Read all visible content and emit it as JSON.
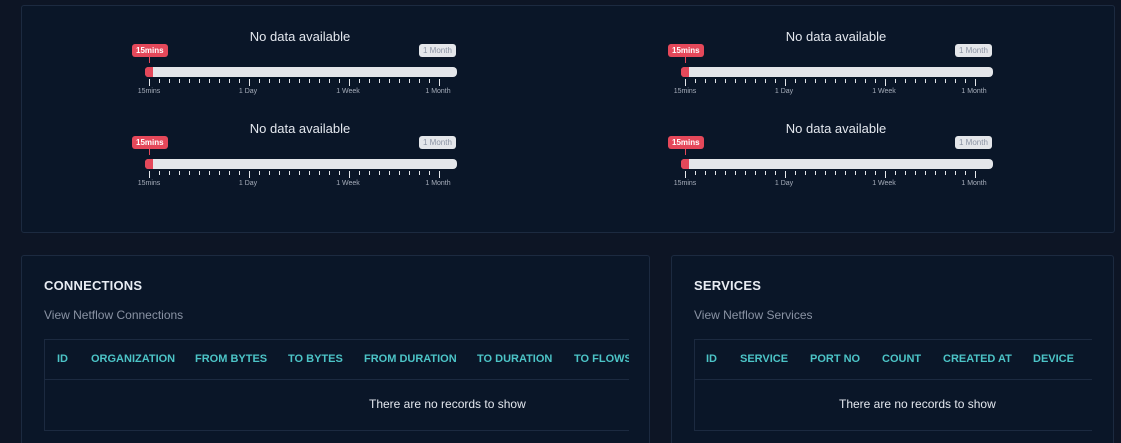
{
  "range_widgets": [
    {
      "nodata": "No data available",
      "min_label": "15mins",
      "max_label": "1 Month",
      "ticks": [
        "15mins",
        "1 Day",
        "1 Week",
        "1 Month"
      ]
    },
    {
      "nodata": "No data available",
      "min_label": "15mins",
      "max_label": "1 Month",
      "ticks": [
        "15mins",
        "1 Day",
        "1 Week",
        "1 Month"
      ]
    },
    {
      "nodata": "No data available",
      "min_label": "15mins",
      "max_label": "1 Month",
      "ticks": [
        "15mins",
        "1 Day",
        "1 Week",
        "1 Month"
      ]
    },
    {
      "nodata": "No data available",
      "min_label": "15mins",
      "max_label": "1 Month",
      "ticks": [
        "15mins",
        "1 Day",
        "1 Week",
        "1 Month"
      ]
    }
  ],
  "connections": {
    "title": "CONNECTIONS",
    "subtitle": "View Netflow Connections",
    "columns": [
      "ID",
      "ORGANIZATION",
      "FROM BYTES",
      "TO BYTES",
      "FROM DURATION",
      "TO DURATION",
      "TO FLOWS"
    ],
    "empty_text": "There are no records to show"
  },
  "services": {
    "title": "SERVICES",
    "subtitle": "View Netflow Services",
    "columns": [
      "ID",
      "SERVICE",
      "PORT NO",
      "COUNT",
      "CREATED AT",
      "DEVICE"
    ],
    "empty_text": "There are no records to show"
  },
  "colors": {
    "accent_red": "#e5485a",
    "header_teal": "#4cc4c7",
    "panel_bg": "#0a1628"
  }
}
